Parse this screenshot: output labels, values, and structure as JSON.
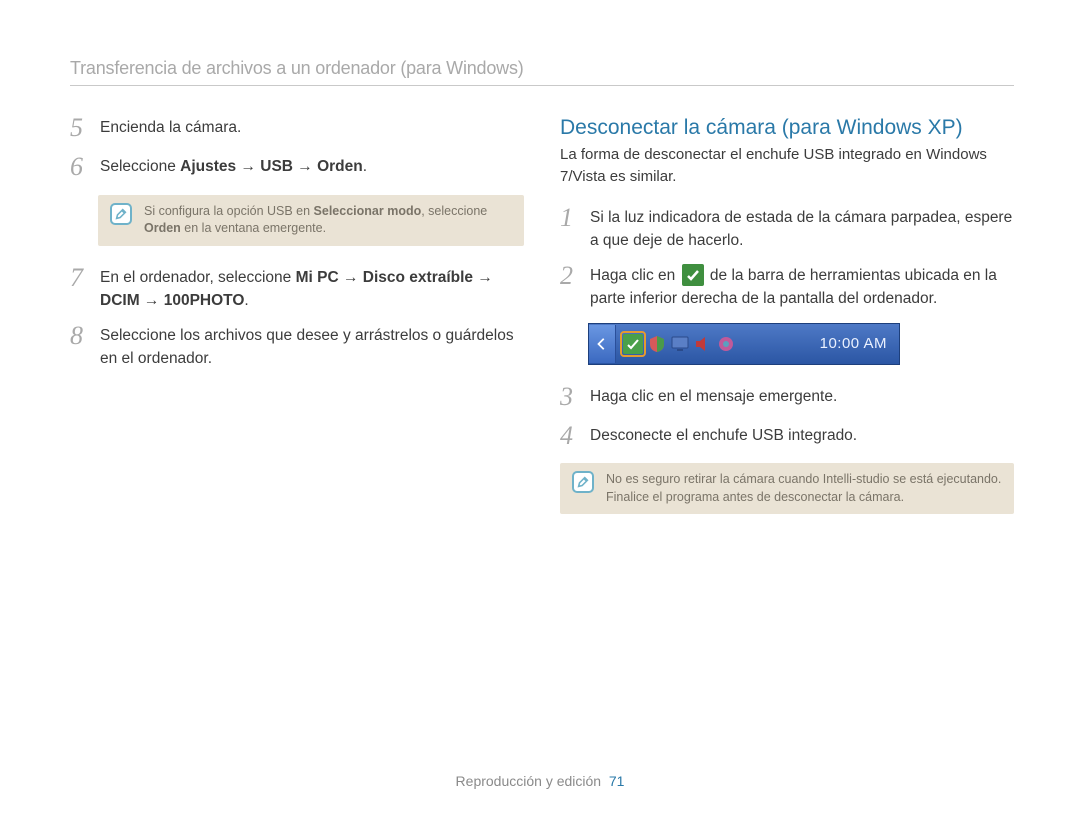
{
  "header": {
    "title": "Transferencia de archivos a un ordenador (para Windows)"
  },
  "left": {
    "steps": {
      "5": {
        "num": "5",
        "text": "Encienda la cámara."
      },
      "6": {
        "num": "6",
        "prefix": "Seleccione ",
        "bold": "Ajustes → USB  → Orden",
        "suffix": "."
      },
      "7": {
        "num": "7",
        "prefix": "En el ordenador, seleccione ",
        "bold": "Mi PC → Disco extraíble → DCIM → 100PHOTO",
        "suffix": "."
      },
      "8": {
        "num": "8",
        "text": "Seleccione los archivos que desee y arrástrelos o guárdelos en el ordenador."
      }
    },
    "note": {
      "pre": "Si configura la opción USB en ",
      "b1": "Seleccionar modo",
      "mid": ", seleccione ",
      "b2": "Orden",
      "post": " en la ventana emergente."
    }
  },
  "right": {
    "title": "Desconectar la cámara (para Windows XP)",
    "intro": "La forma de desconectar el enchufe USB integrado en Windows 7/Vista es similar.",
    "steps": {
      "1": {
        "num": "1",
        "text": "Si la luz indicadora de estada de la cámara parpadea, espere a que deje de hacerlo."
      },
      "2": {
        "num": "2",
        "pre": "Haga clic en ",
        "post": " de la barra de herramientas ubicada en la parte inferior derecha de la pantalla del ordenador."
      },
      "3": {
        "num": "3",
        "text": "Haga clic en el mensaje emergente."
      },
      "4": {
        "num": "4",
        "text": "Desconecte el enchufe USB integrado."
      }
    },
    "taskbar": {
      "time": "10:00 AM"
    },
    "note": {
      "line1": "No es seguro retirar la cámara cuando Intelli-studio se está ejecutando.",
      "line2": "Finalice el programa antes de desconectar la cámara."
    }
  },
  "footer": {
    "section": "Reproducción y edición",
    "page": "71"
  }
}
